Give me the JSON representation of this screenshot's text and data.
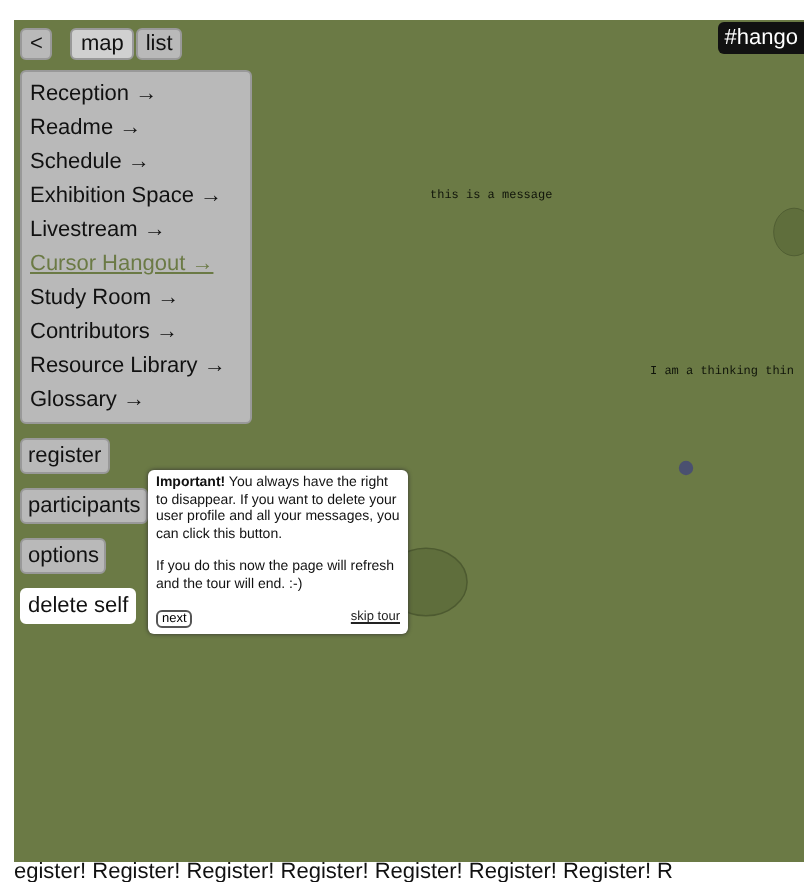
{
  "nav": {
    "back": "<",
    "views": [
      {
        "label": "map",
        "selected": true
      },
      {
        "label": "list",
        "selected": false
      }
    ]
  },
  "rooms": [
    {
      "label": "Reception →",
      "selected": false
    },
    {
      "label": "Readme →",
      "selected": false
    },
    {
      "label": "Schedule →",
      "selected": false
    },
    {
      "label": "Exhibition Space →",
      "selected": false
    },
    {
      "label": "Livestream →",
      "selected": false
    },
    {
      "label": "Cursor Hangout →",
      "selected": true
    },
    {
      "label": "Study Room →",
      "selected": false
    },
    {
      "label": "Contributors →",
      "selected": false
    },
    {
      "label": "Resource Library →",
      "selected": false
    },
    {
      "label": "Glossary →",
      "selected": false
    }
  ],
  "actions": [
    {
      "label": "register",
      "highlighted": false
    },
    {
      "label": "participants",
      "highlighted": false
    },
    {
      "label": "options",
      "highlighted": false
    },
    {
      "label": "delete self",
      "highlighted": true
    }
  ],
  "channel_tag": "#hango",
  "canvas_messages": [
    "this is a message",
    "I am a thinking thin"
  ],
  "tour": {
    "text": "**Important!** You always have the right to disappear. If you want to delete your user profile and all your messages, you can click this button.",
    "text_2": "If you do this now the page will refresh and the tour will end. :-)",
    "next": "next",
    "skip": "skip tour"
  },
  "ticker": "egister! Register! Register! Register! Register! Register! Register! R"
}
